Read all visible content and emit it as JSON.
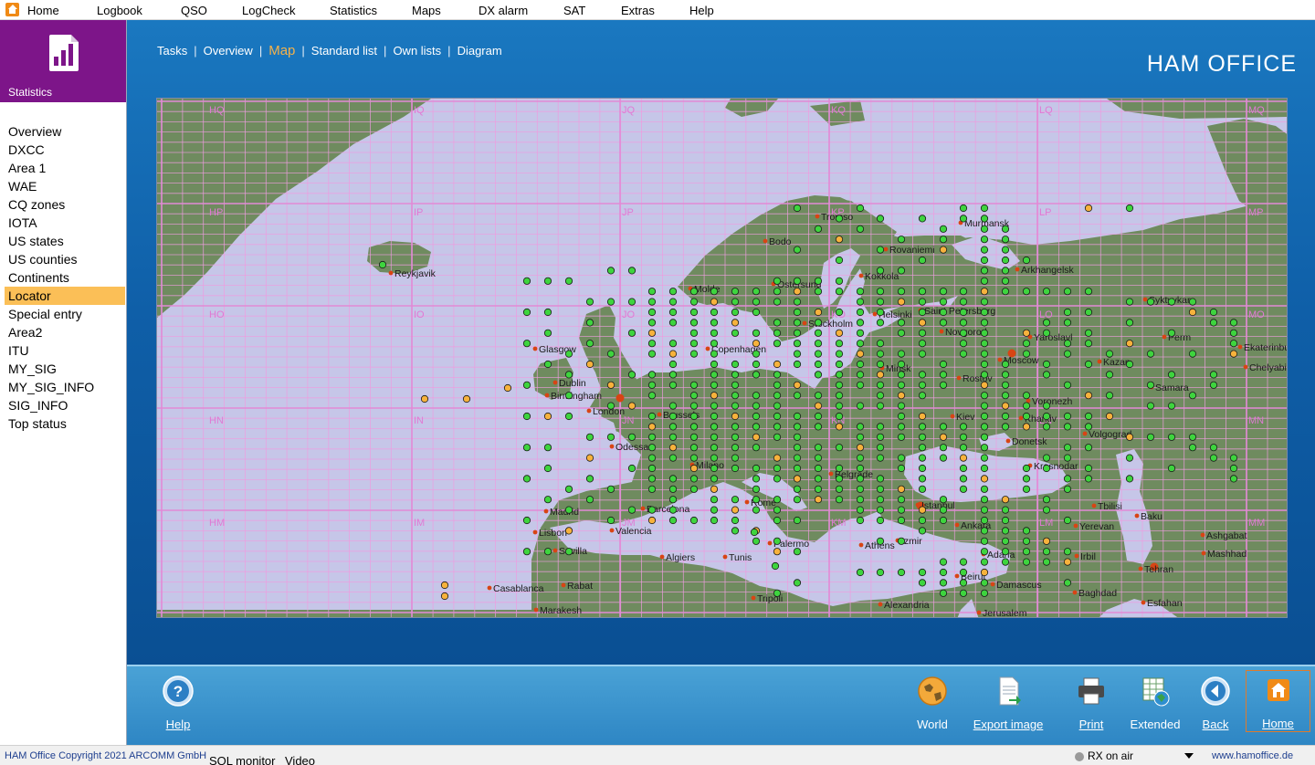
{
  "menubar": {
    "items": [
      "Home",
      "Logbook",
      "QSO",
      "LogCheck",
      "Statistics",
      "Maps",
      "DX alarm",
      "SAT",
      "Extras",
      "Help"
    ]
  },
  "sidebar": {
    "title": "Statistics",
    "items": [
      {
        "label": "Overview"
      },
      {
        "label": "DXCC"
      },
      {
        "label": "Area 1"
      },
      {
        "label": "WAE"
      },
      {
        "label": "CQ zones"
      },
      {
        "label": "IOTA"
      },
      {
        "label": "US states"
      },
      {
        "label": "US counties"
      },
      {
        "label": "Continents"
      },
      {
        "label": "Locator",
        "active": true
      },
      {
        "label": "Special entry"
      },
      {
        "label": "Area2"
      },
      {
        "label": "ITU"
      },
      {
        "label": "MY_SIG"
      },
      {
        "label": "MY_SIG_INFO"
      },
      {
        "label": "SIG_INFO"
      },
      {
        "label": "Top status"
      }
    ]
  },
  "tabs": [
    {
      "label": "Tasks"
    },
    {
      "label": "Overview"
    },
    {
      "label": "Map",
      "active": true
    },
    {
      "label": "Standard list"
    },
    {
      "label": "Own lists"
    },
    {
      "label": "Diagram"
    }
  ],
  "brand": "HAM OFFICE",
  "map": {
    "colors": {
      "sea": "#c6c6e8",
      "land": "#6f8b5f",
      "grid_major": "#e28ad6",
      "grid_minor": "#ee9ce0",
      "confirmed": "#3ed43e",
      "worked": "#f7b23c",
      "city": "#d84414"
    },
    "field_labels": [
      "HQ",
      "IQ",
      "JQ",
      "KQ",
      "LQ",
      "MQ",
      "HP",
      "IP",
      "JP",
      "KP",
      "LP",
      "MP",
      "HO",
      "IO",
      "JO",
      "KO",
      "LO",
      "MO",
      "HN",
      "IN",
      "JN",
      "KN",
      "LN",
      "MN",
      "HM",
      "IM",
      "JM",
      "KM",
      "LM",
      "MM"
    ],
    "cities": [
      "Reykjavik",
      "Tromso",
      "Murmansk",
      "Bodo",
      "Rovaniemi",
      "Arkhangelsk",
      "Molde",
      "Ostersund",
      "Kokkola",
      "Syktyvkar",
      "Stockholm",
      "Helsinki",
      "Saint Petersburg",
      "Glasgow",
      "Novgorod",
      "Yaroslavl",
      "Perm",
      "Ekaterinburg",
      "Copenhagen",
      "Moscow",
      "Kazan",
      "Chelyabinsk",
      "Dublin",
      "Birmingham",
      "London",
      "Minsk",
      "Rostov",
      "Samara",
      "Brussels",
      "Voronezh",
      "Kiev",
      "Kharkiv",
      "Volgograd",
      "Odessa",
      "Donetsk",
      "Krasnodar",
      "Milano",
      "Belgrade",
      "Istanbul",
      "Tbilisi",
      "Baku",
      "Rome",
      "Madrid",
      "Barcelona",
      "Lisbon",
      "Valencia",
      "Ankara",
      "Yerevan",
      "Ashgabat",
      "Sevilla",
      "Algiers",
      "Tunis",
      "Palermo",
      "Athens",
      "Izmir",
      "Adana",
      "Irbil",
      "Mashhad",
      "Tehran",
      "Casablanca",
      "Rabat",
      "Beirut",
      "Damascus",
      "Baghdad",
      "Marakesh",
      "Tripoli",
      "Alexandria",
      "Jerusalem",
      "Esfahan"
    ]
  },
  "bottombar": {
    "help": "Help",
    "world": "World",
    "export": "Export image",
    "print": "Print",
    "extended": "Extended",
    "back": "Back",
    "home": "Home"
  },
  "statusbar": {
    "copyright": "HAM Office Copyright 2021 ARCOMM GmbH",
    "sql": "SQL monitor",
    "video": "Video",
    "rx": "RX on air",
    "url": "www.hamoffice.de"
  }
}
